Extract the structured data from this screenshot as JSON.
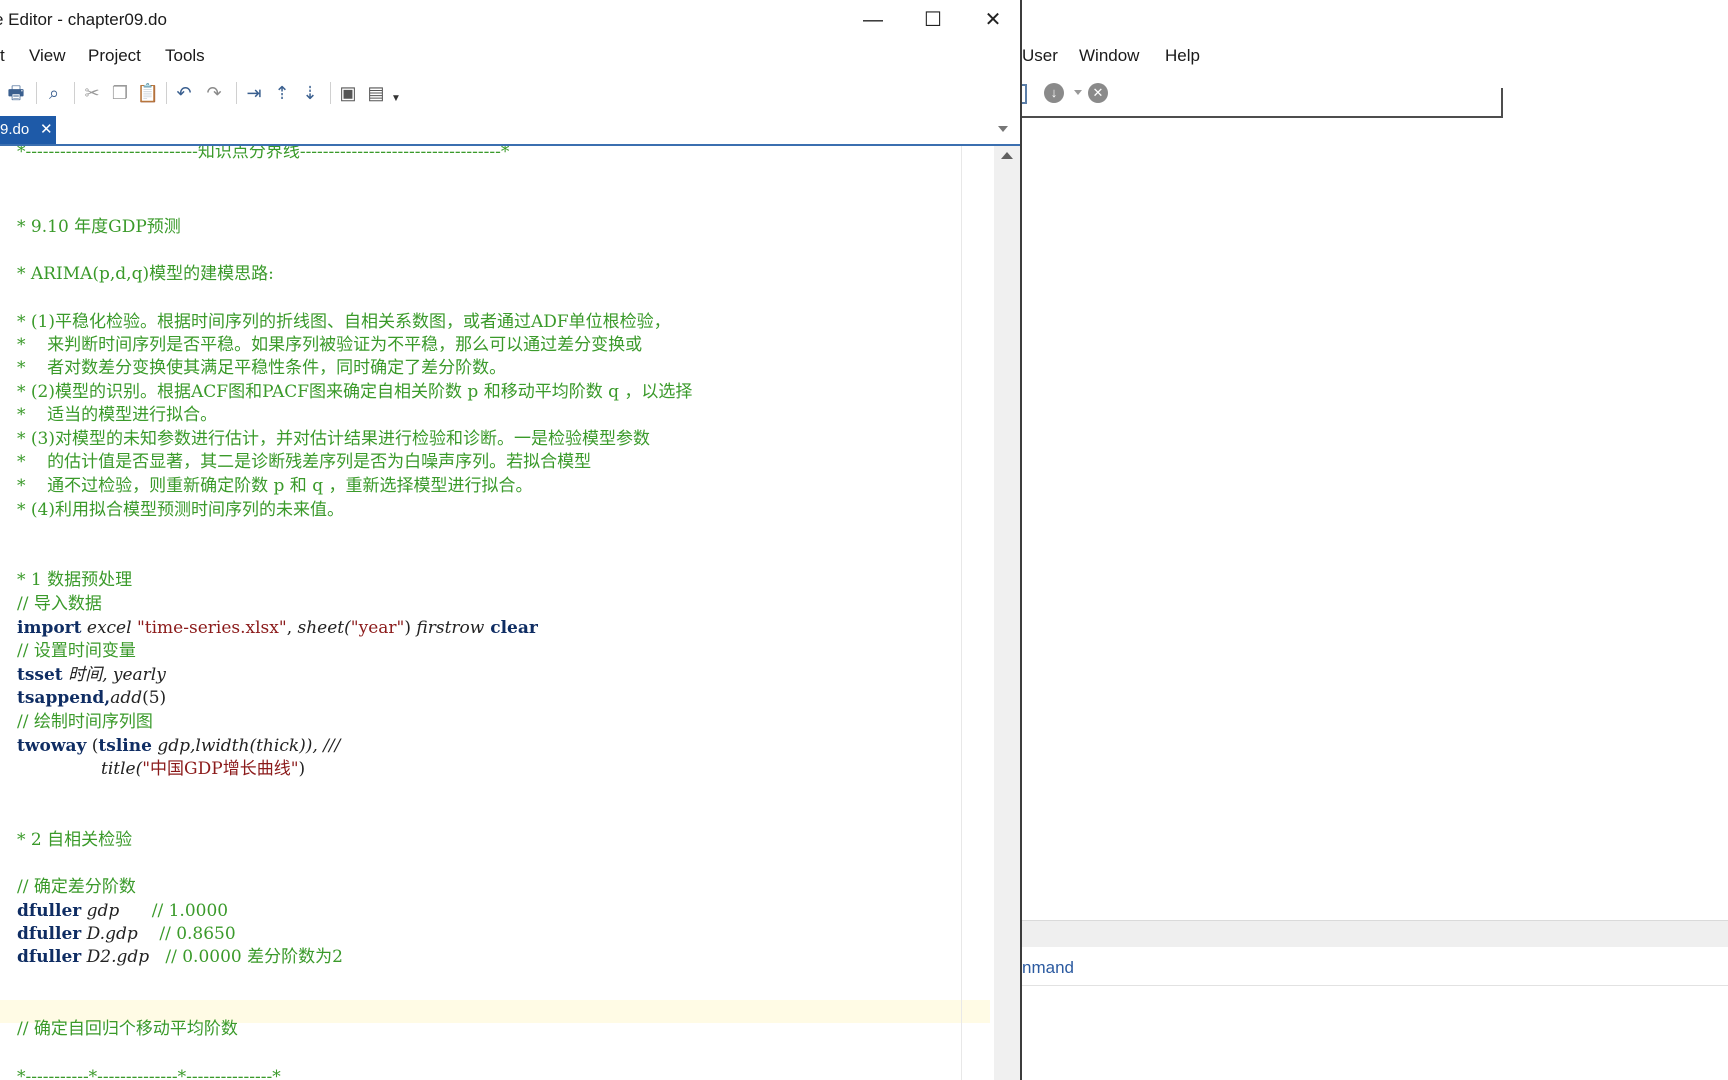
{
  "editor": {
    "title": "e Editor - chapter09.do",
    "window_controls": {
      "minimize": "—",
      "maximize": "☐",
      "close": "✕"
    },
    "menu": [
      "t",
      "View",
      "Project",
      "Tools"
    ],
    "tab": {
      "label": "9.do",
      "close": "✕"
    },
    "code": {
      "divider": "*------------------------------知识点分界线-----------------------------------*",
      "heading_910": "* 9.10 年度GDP预测",
      "arima_title": "* ARIMA(p,d,q)模型的建模思路:",
      "step1_a": "* (1)平稳化检验。根据时间序列的折线图、自相关系数图，或者通过ADF单位根检验，",
      "step1_b": "*    来判断时间序列是否平稳。如果序列被验证为不平稳，那么可以通过差分变换或",
      "step1_c": "*    者对数差分变换使其满足平稳性条件，同时确定了差分阶数。",
      "step2_a": "* (2)模型的识别。根据ACF图和PACF图来确定自相关阶数 p 和移动平均阶数 q ，以选择",
      "step2_b": "*    适当的模型进行拟合。",
      "step3_a": "* (3)对模型的未知参数进行估计，并对估计结果进行检验和诊断。一是检验模型参数",
      "step3_b": "*    的估计值是否显著，其二是诊断残差序列是否为白噪声序列。若拟合模型",
      "step3_c": "*    通不过检验，则重新确定阶数 p 和 q ，重新选择模型进行拟合。",
      "step4": "* (4)利用拟合模型预测时间序列的未来值。",
      "sec1": "* 1 数据预处理",
      "c_import": "// 导入数据",
      "import_kw": "import",
      "import_excel": " excel ",
      "import_file": "\"time-series.xlsx\"",
      "import_comma": ", ",
      "import_sheet": "sheet(",
      "import_sheet_val": "\"year\"",
      "import_close": ") ",
      "import_firstrow": "firstrow",
      "import_clear": " clear",
      "c_tsset": "// 设置时间变量",
      "tsset_kw": "tsset",
      "tsset_args": " 时间, yearly",
      "tsappend_kw": "tsappend,",
      "tsappend_add": "add",
      "tsappend_num": "(5)",
      "c_plot": "// 绘制时间序列图",
      "twoway_kw": "twoway",
      "twoway_open": " (",
      "tsline_kw": "tsline",
      "twoway_args": " gdp,lwidth(thick)), ///",
      "title_fn": "title(",
      "title_str": "\"中国GDP增长曲线\"",
      "title_close": ")",
      "sec2": "* 2 自相关检验",
      "c_diff": "// 确定差分阶数",
      "df_kw": "dfuller",
      "df1_arg": " gdp      ",
      "df1_cmt": "// 1.0000",
      "df2_arg": " D.gdp    ",
      "df2_cmt": "// 0.8650",
      "df3_arg": " D2.gdp   ",
      "df3_cmt": "// 0.0000 差分阶数为2",
      "c_arma": "// 确定自回归个移动平均阶数",
      "bottom_divider": "*-----------*--------------*---------------*"
    }
  },
  "background_window": {
    "menu": [
      "User",
      "Window",
      "Help"
    ],
    "toolbar_icons": [
      "down-arrow-icon",
      "close-circle-icon"
    ],
    "command_label": "nmand"
  },
  "colors": {
    "comment": "#3a9a2a",
    "keyword": "#0f2d63",
    "string": "#8b1a1a",
    "tab_active": "#1e5aa8"
  }
}
